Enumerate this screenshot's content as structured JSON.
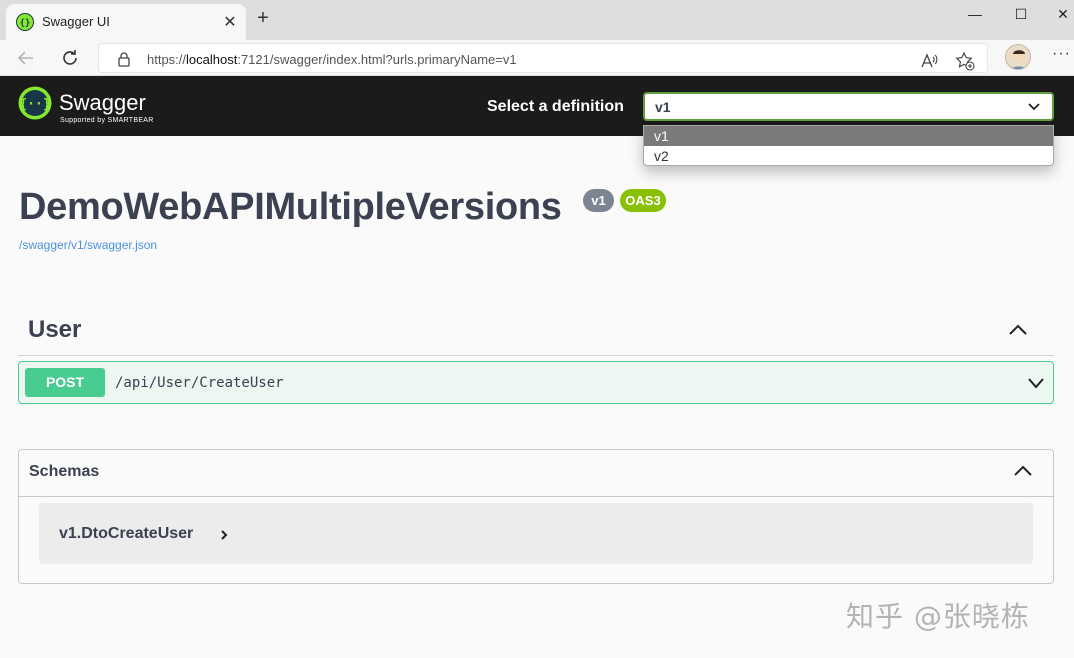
{
  "browser": {
    "tab_title": "Swagger UI",
    "tab_close": "✕",
    "new_tab": "+",
    "url_prefix": "https://",
    "url_host": "localhost",
    "url_rest": ":7121/swagger/index.html?urls.primaryName=v1",
    "menu": "···",
    "window_controls": {
      "minimize": "—",
      "maximize": "☐",
      "close": "✕"
    }
  },
  "topbar": {
    "logo_text": "Swagger",
    "logo_sub": "Supported by SMARTBEAR",
    "select_label": "Select a definition",
    "selected": "v1",
    "options": [
      "v1",
      "v2"
    ]
  },
  "info": {
    "title": "DemoWebAPIMultipleVersions",
    "version_badge": "v1",
    "oas_badge": "OAS3",
    "spec_link": "/swagger/v1/swagger.json"
  },
  "tags": [
    {
      "name": "User",
      "operations": [
        {
          "method": "POST",
          "path": "/api/User/CreateUser"
        }
      ]
    }
  ],
  "schemas": {
    "title": "Schemas",
    "models": [
      "v1.DtoCreateUser"
    ]
  },
  "watermark": "知乎 @张晓栋",
  "colors": {
    "topbar_bg": "#1b1b1b",
    "post": "#49cc90",
    "select_border": "#62a03f",
    "oas_badge": "#89bf04",
    "version_badge": "#7d8492",
    "link": "#4990e2"
  }
}
